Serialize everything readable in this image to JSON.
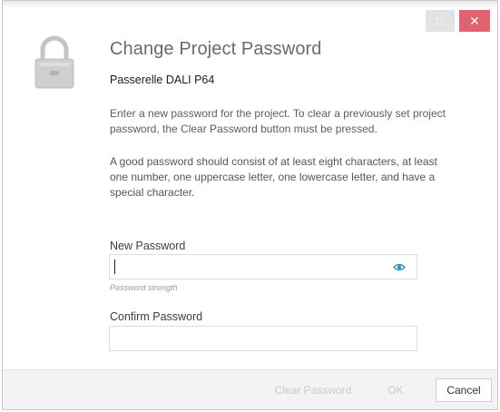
{
  "window": {
    "minimize_glyph": "□",
    "close_glyph": "✕"
  },
  "header": {
    "icon": "lock-icon",
    "title": "Change Project Password",
    "subtitle": "Passerelle DALI P64"
  },
  "body": {
    "instructions": "Enter a new password for the project. To clear a previously set project password, the Clear Password button must be pressed.",
    "guidance": "A good password should consist of at least eight characters, at least one number, one uppercase letter, one lowercase letter, and have a special character."
  },
  "form": {
    "new_password_label": "New Password",
    "new_password_value": "",
    "reveal_icon": "eye-icon",
    "strength_text": "Password strength",
    "confirm_password_label": "Confirm Password",
    "confirm_password_value": ""
  },
  "footer": {
    "clear_label": "Clear Password",
    "ok_label": "OK",
    "cancel_label": "Cancel"
  },
  "colors": {
    "close_button": "#e06370",
    "eye_icon": "#2f8fbf"
  }
}
